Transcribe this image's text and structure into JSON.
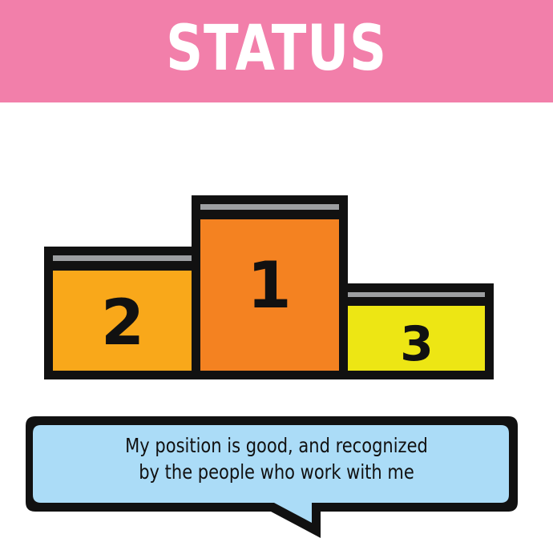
{
  "header": {
    "title": "STATUS"
  },
  "podium": {
    "places": [
      {
        "place": "1",
        "color": "#f48221"
      },
      {
        "place": "2",
        "color": "#f9a81a"
      },
      {
        "place": "3",
        "color": "#ede614"
      }
    ],
    "stripe_color": "#9d9fa2",
    "outline_color": "#111111"
  },
  "speech_bubble": {
    "line1": "My position is good, and recognized",
    "line2": "by the people who work with me",
    "fill_color": "#abdcf7"
  },
  "colors": {
    "banner": "#f27faa",
    "title_text": "#ffffff"
  }
}
